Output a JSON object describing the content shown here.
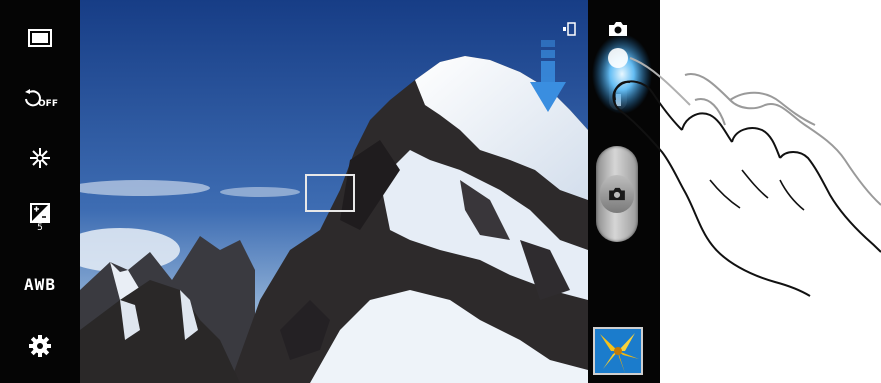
{
  "left_toolbar": {
    "items": [
      {
        "name": "shooting-mode",
        "icon": "frame-icon"
      },
      {
        "name": "timer",
        "icon": "timer-off-icon",
        "badge": "OFF"
      },
      {
        "name": "effects",
        "icon": "sparkle-icon"
      },
      {
        "name": "exposure",
        "icon": "exposure-icon",
        "value": "5"
      },
      {
        "name": "white-balance",
        "icon": "awb-icon",
        "label": "AWB"
      },
      {
        "name": "settings",
        "icon": "gear-icon"
      }
    ]
  },
  "right_toolbar": {
    "mode_icon": "camera-icon",
    "shutter_icon": "camera-icon",
    "storage_icon": "phone-storage-icon"
  },
  "colors": {
    "sky": "#1f4a8c",
    "snow": "#f2f6fb",
    "rock": "#2c2a2a",
    "highlight": "#4bb4ff"
  }
}
